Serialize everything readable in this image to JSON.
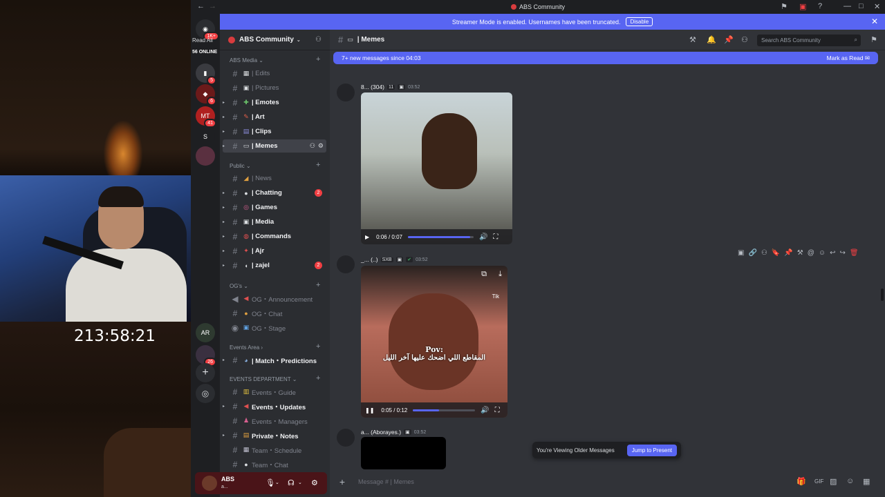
{
  "window": {
    "title": "ABS Community"
  },
  "streamer_bar": {
    "text": "Streamer Mode is enabled. Usernames have been truncated.",
    "disable_label": "Disable"
  },
  "overlay": {
    "timer": "213:58:21"
  },
  "guilds": {
    "read_all": "Read All",
    "online": "56 ONLINE",
    "top_badge": "1K+",
    "items": [
      {
        "label": "",
        "badge": "5"
      },
      {
        "label": "",
        "badge": "6"
      },
      {
        "label": "MT",
        "badge": "41"
      },
      {
        "label": "S",
        "badge": ""
      },
      {
        "label": "",
        "badge": ""
      },
      {
        "label": "AR",
        "badge": ""
      },
      {
        "label": "",
        "badge": "26"
      }
    ]
  },
  "server": {
    "name": "ABS Community"
  },
  "categories": {
    "abs_media": "ABS Media",
    "public": "Public",
    "ogs": "OG's",
    "events_area": "Events Area",
    "events_department": "EVENTS DEPARTMENT"
  },
  "channels": {
    "edits": "| Edits",
    "pictures": "| Pictures",
    "emotes": "| Emotes",
    "art": "| Art",
    "clips": "| Clips",
    "memes": "| Memes",
    "news": "| News",
    "chatting": "| Chatting",
    "chatting_badge": "2",
    "games": "| Games",
    "media": "| Media",
    "commands": "| Commands",
    "ajr": "| Ajr",
    "zajel": "| zajel",
    "zajel_badge": "2",
    "og_announcement": "OG・Announcement",
    "og_chat": "OG・Chat",
    "og_stage": "OG・Stage",
    "match_predictions": "| Match・Predictions",
    "events_guide": "Events・Guide",
    "events_updates": "Events・Updates",
    "events_managers": "Events・Managers",
    "private_notes": "Private・Notes",
    "team_schedule": "Team・Schedule",
    "team_chat": "Team・Chat"
  },
  "user_panel": {
    "name": "ABS",
    "status": "a..."
  },
  "chat": {
    "channel_title": "| Memes",
    "search_placeholder": "Search ABS Community",
    "new_messages": "7+ new messages since 04:03",
    "mark_as_read": "Mark as Read",
    "messages": [
      {
        "author": "8... (304)",
        "badge": "11",
        "time": "03:52",
        "video_time": "0:06 / 0:07",
        "progress": 0.95
      },
      {
        "author": "_... (..)",
        "badge": "SXB",
        "time": "03:52",
        "video_time": "0:05 / 0:12",
        "progress": 0.42,
        "overlay_pov": "Pov:",
        "overlay_caption": "المقاطع اللي اضحك عليها آخر الليل",
        "overlay_tik": "Tik"
      },
      {
        "author": "a... (Aborayes.)",
        "time": "03:52"
      }
    ],
    "older_notice": "You're Viewing Older Messages",
    "jump_label": "Jump to Present",
    "composer_placeholder": "Message # | Memes"
  }
}
